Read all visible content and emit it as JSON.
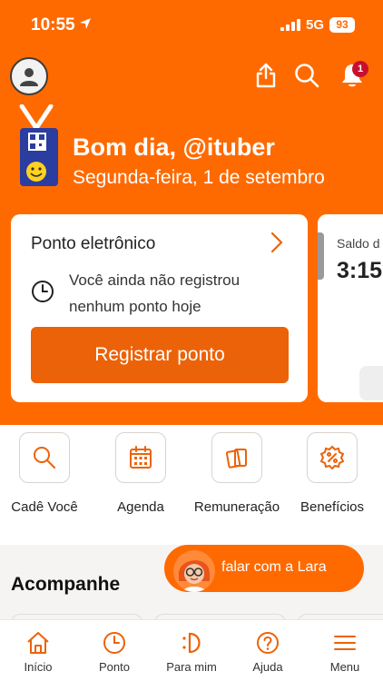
{
  "status_bar": {
    "time": "10:55",
    "network": "5G",
    "battery": "93"
  },
  "header": {
    "notification_count": "1"
  },
  "greeting": {
    "title": "Bom dia, @ituber",
    "date": "Segunda-feira, 1 de setembro"
  },
  "ponto_card": {
    "title": "Ponto eletrônico",
    "message": "Você ainda não registrou nenhum ponto hoje",
    "button": "Registrar ponto"
  },
  "saldo_card": {
    "label": "Saldo d",
    "value": "3:15"
  },
  "quick_actions": [
    {
      "label": "Cadê Você",
      "icon": "magnifier-icon"
    },
    {
      "label": "Agenda",
      "icon": "calendar-icon"
    },
    {
      "label": "Remuneração",
      "icon": "cards-icon"
    },
    {
      "label": "Benefícios",
      "icon": "percent-badge-icon"
    }
  ],
  "lara": {
    "label": "falar com a Lara"
  },
  "section": {
    "title": "Acompanhe"
  },
  "tabs": [
    {
      "label": "Início",
      "icon": "home-icon"
    },
    {
      "label": "Ponto",
      "icon": "clock-icon"
    },
    {
      "label": "Para mim",
      "icon": "para-mim-icon"
    },
    {
      "label": "Ajuda",
      "icon": "help-icon"
    },
    {
      "label": "Menu",
      "icon": "menu-icon"
    }
  ],
  "colors": {
    "brand_orange": "#ff6a00",
    "button_orange": "#ec6208",
    "badge_red": "#c8102e"
  }
}
